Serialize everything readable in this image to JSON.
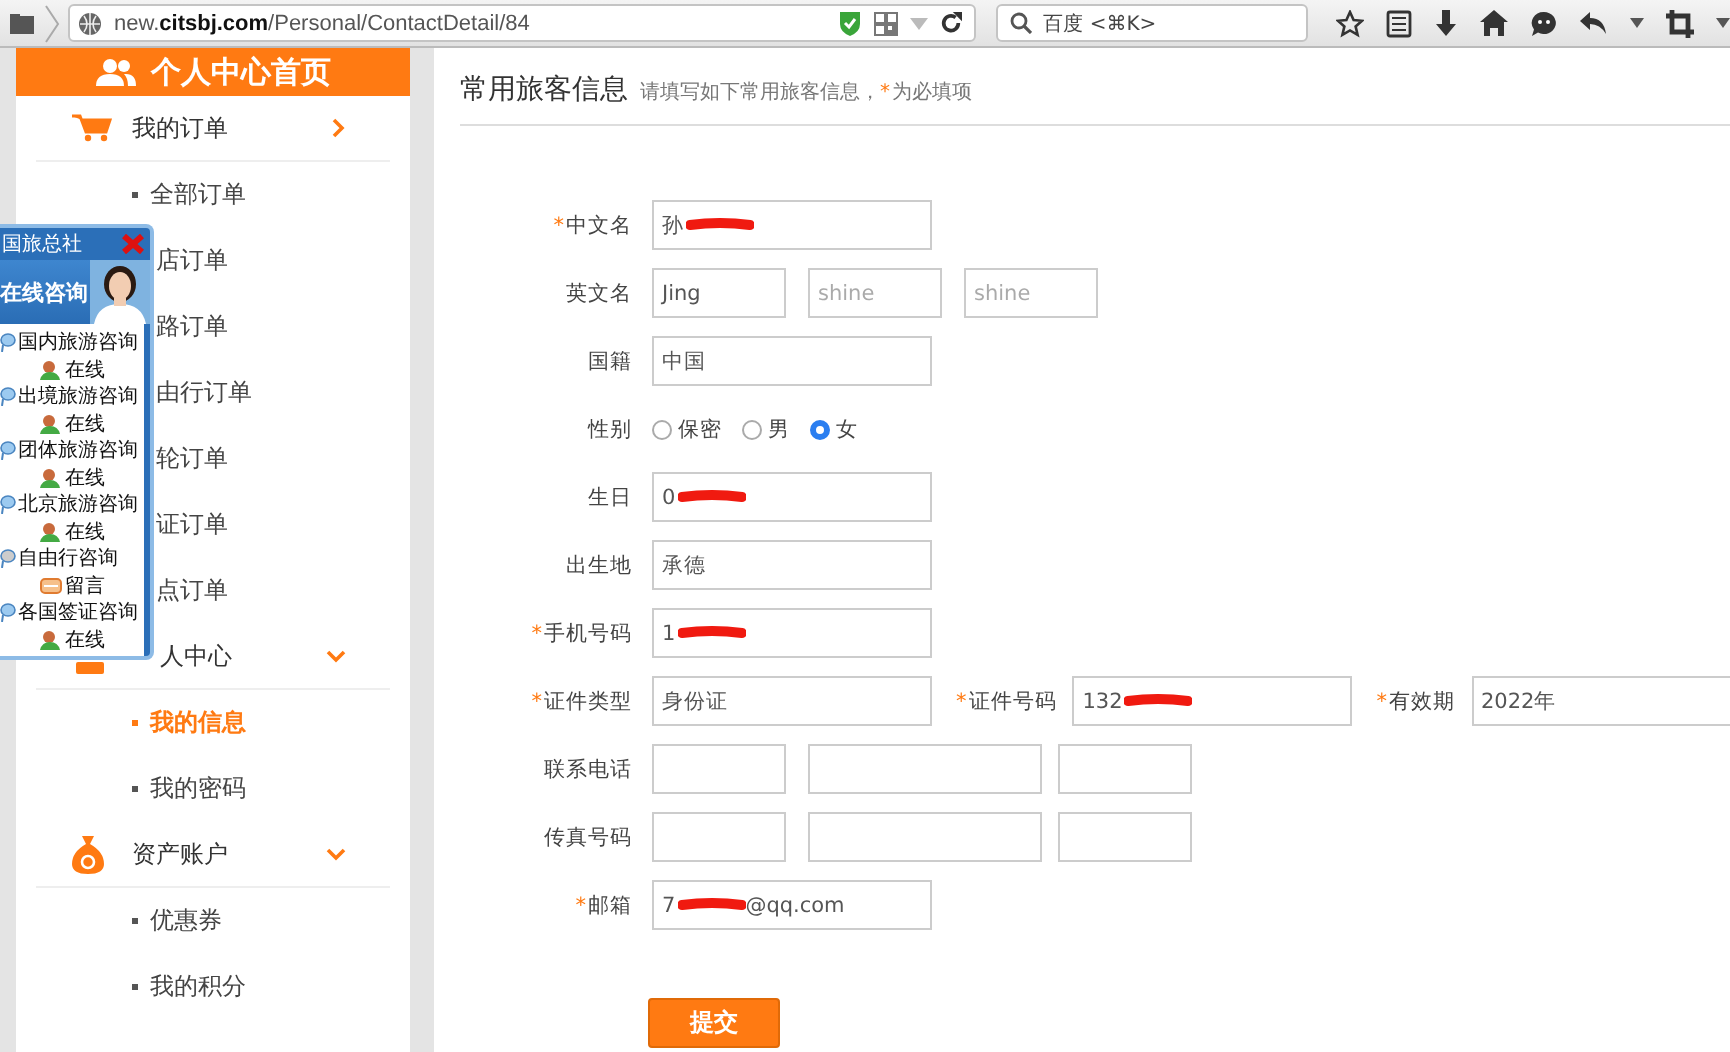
{
  "browser": {
    "url": "new.**citsbj.com**/Personal/ContactDetail/84",
    "search_placeholder": "百度 <⌘K>"
  },
  "sidebar": {
    "header": "个人中心首页",
    "sections": [
      {
        "title": "我的订单",
        "kind": "orders",
        "covered": false,
        "expanded": false,
        "items": [
          {
            "label": "全部订单",
            "selected": false,
            "covered": false
          },
          {
            "label": "店订单",
            "selected": false,
            "covered": true
          },
          {
            "label": "路订单",
            "selected": false,
            "covered": true
          },
          {
            "label": "由行订单",
            "selected": false,
            "covered": true
          },
          {
            "label": "轮订单",
            "selected": false,
            "covered": true
          },
          {
            "label": "证订单",
            "selected": false,
            "covered": true
          },
          {
            "label": "点订单",
            "selected": false,
            "covered": true
          }
        ]
      },
      {
        "title": "人中心",
        "kind": "profile",
        "covered": true,
        "expanded": true,
        "items": [
          {
            "label": "我的信息",
            "selected": true,
            "covered": false
          },
          {
            "label": "我的密码",
            "selected": false,
            "covered": false
          }
        ]
      },
      {
        "title": "资产账户",
        "kind": "assets",
        "covered": false,
        "expanded": true,
        "items": [
          {
            "label": "优惠券",
            "selected": false,
            "covered": false
          },
          {
            "label": "我的积分",
            "selected": false,
            "covered": false
          }
        ]
      }
    ]
  },
  "chat": {
    "title": "国旅总社",
    "banner": "在线咨询",
    "services": [
      {
        "label": "国内旅游咨询",
        "status": "在线",
        "kind": "online"
      },
      {
        "label": "出境旅游咨询",
        "status": "在线",
        "kind": "online"
      },
      {
        "label": "团体旅游咨询",
        "status": "在线",
        "kind": "online"
      },
      {
        "label": "北京旅游咨询",
        "status": "在线",
        "kind": "online"
      },
      {
        "label": "自由行咨询",
        "status": "留言",
        "kind": "message"
      },
      {
        "label": "各国签证咨询",
        "status": "在线",
        "kind": "online"
      }
    ]
  },
  "form": {
    "title": "常用旅客信息",
    "hint_start": "请填写如下常用旅客信息，",
    "hint_mark": "*",
    "hint_end": "为必填项",
    "rows": [
      {
        "kind": "fields",
        "groups": [
          {
            "label": "中文名",
            "required": true,
            "fields": [
              {
                "kind": "full",
                "value": "孙",
                "redacted": true
              }
            ]
          }
        ]
      },
      {
        "kind": "fields",
        "groups": [
          {
            "label": "英文名",
            "required": false,
            "fields": [
              {
                "kind": "small",
                "value": "Jing"
              },
              {
                "kind": "small",
                "placeholder": "shine"
              },
              {
                "kind": "small",
                "placeholder": "shine"
              }
            ]
          }
        ]
      },
      {
        "kind": "fields",
        "groups": [
          {
            "label": "国籍",
            "required": false,
            "fields": [
              {
                "kind": "full",
                "value": "中国"
              }
            ]
          }
        ]
      },
      {
        "kind": "radio",
        "label": "性别",
        "required": false,
        "options": [
          {
            "label": "保密",
            "selected": false
          },
          {
            "label": "男",
            "selected": false
          },
          {
            "label": "女",
            "selected": true
          }
        ]
      },
      {
        "kind": "fields",
        "groups": [
          {
            "label": "生日",
            "required": false,
            "fields": [
              {
                "kind": "full",
                "value": "0",
                "redacted": true
              }
            ]
          }
        ]
      },
      {
        "kind": "fields",
        "groups": [
          {
            "label": "出生地",
            "required": false,
            "fields": [
              {
                "kind": "full",
                "value": "承德"
              }
            ]
          }
        ]
      },
      {
        "kind": "fields",
        "groups": [
          {
            "label": "手机号码",
            "required": true,
            "fields": [
              {
                "kind": "full",
                "value": "1",
                "redacted": true
              }
            ]
          }
        ]
      },
      {
        "kind": "fields",
        "groups": [
          {
            "label": "证件类型",
            "required": true,
            "fields": [
              {
                "kind": "full",
                "value": "身份证"
              }
            ]
          },
          {
            "label": "证件号码",
            "required": true,
            "fields": [
              {
                "kind": "full",
                "value": "132",
                "redacted": true
              }
            ]
          },
          {
            "label": "有效期",
            "required": true,
            "fields": [
              {
                "kind": "full",
                "value": "2022年"
              }
            ]
          }
        ]
      },
      {
        "kind": "fields",
        "groups": [
          {
            "label": "联系电话",
            "required": false,
            "fields": [
              {
                "kind": "small"
              },
              {
                "kind": "mid"
              },
              {
                "kind": "small"
              }
            ]
          }
        ]
      },
      {
        "kind": "fields",
        "groups": [
          {
            "label": "传真号码",
            "required": false,
            "fields": [
              {
                "kind": "small"
              },
              {
                "kind": "mid"
              },
              {
                "kind": "small"
              }
            ]
          }
        ]
      },
      {
        "kind": "fields",
        "groups": [
          {
            "label": "邮箱",
            "required": true,
            "fields": [
              {
                "kind": "full",
                "value": "7",
                "redacted": true,
                "value_end": "@qq.com"
              }
            ]
          }
        ]
      }
    ],
    "submit": "提交"
  }
}
